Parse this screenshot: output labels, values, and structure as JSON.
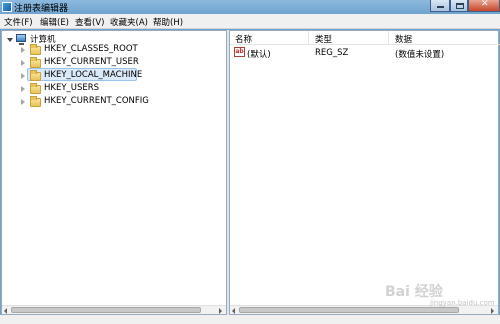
{
  "window": {
    "title": "注册表编辑器",
    "close_glyph": "✕"
  },
  "menu": {
    "items": [
      {
        "label": "文件(F)"
      },
      {
        "label": "编辑(E)"
      },
      {
        "label": "查看(V)"
      },
      {
        "label": "收藏夹(A)"
      },
      {
        "label": "帮助(H)"
      }
    ]
  },
  "tree": {
    "root": "计算机",
    "keys": [
      {
        "label": "HKEY_CLASSES_ROOT"
      },
      {
        "label": "HKEY_CURRENT_USER"
      },
      {
        "label": "HKEY_LOCAL_MACHINE",
        "selected": true
      },
      {
        "label": "HKEY_USERS"
      },
      {
        "label": "HKEY_CURRENT_CONFIG"
      }
    ]
  },
  "values_pane": {
    "columns": [
      "名称",
      "类型",
      "数据"
    ],
    "rows": [
      {
        "icon": "ab",
        "name": "(默认)",
        "type": "REG_SZ",
        "data": "(数值未设置)"
      }
    ]
  },
  "watermark": {
    "brand": "Bai 经验",
    "url": "jingyan.baidu.com"
  }
}
